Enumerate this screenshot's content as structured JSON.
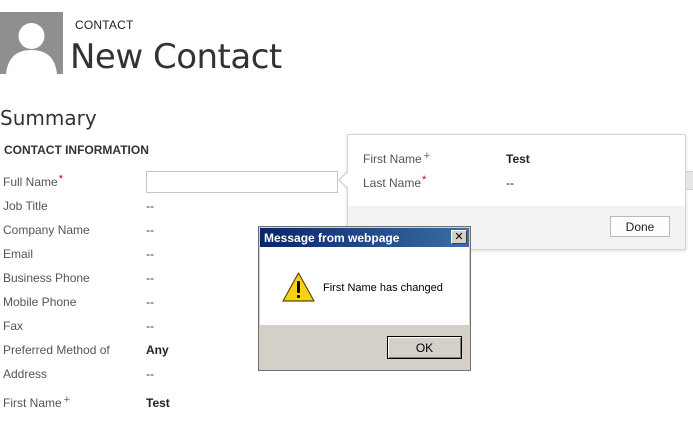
{
  "header": {
    "entity_label": "CONTACT",
    "record_title": "New Contact",
    "avatar_icon": "person-silhouette-icon"
  },
  "form": {
    "section_title": "Summary",
    "subsection_title": "CONTACT INFORMATION",
    "fields": [
      {
        "label": "Full Name",
        "value": "",
        "required": "*"
      },
      {
        "label": "Job Title",
        "value": "--"
      },
      {
        "label": "Company Name",
        "value": "--"
      },
      {
        "label": "Email",
        "value": "--"
      },
      {
        "label": "Business Phone",
        "value": "--"
      },
      {
        "label": "Mobile Phone",
        "value": "--"
      },
      {
        "label": "Fax",
        "value": "--"
      },
      {
        "label": "Preferred Method of",
        "value": "Any"
      },
      {
        "label": "Address",
        "value": "--"
      },
      {
        "label": "First Name",
        "value": "Test",
        "recommended": "+"
      }
    ]
  },
  "flyout": {
    "fields": [
      {
        "label": "First Name",
        "value": "Test",
        "recommended": "+"
      },
      {
        "label": "Last Name",
        "value": "--",
        "required": "*"
      }
    ],
    "done_label": "Done"
  },
  "dialog": {
    "title": "Message from webpage",
    "close_glyph": "✕",
    "message": "First Name has changed",
    "ok_label": "OK",
    "icon": "warning-icon"
  },
  "colors": {
    "required": "#cc0000",
    "recommended": "#2b6fb6",
    "titlebar": "#0a246a"
  }
}
